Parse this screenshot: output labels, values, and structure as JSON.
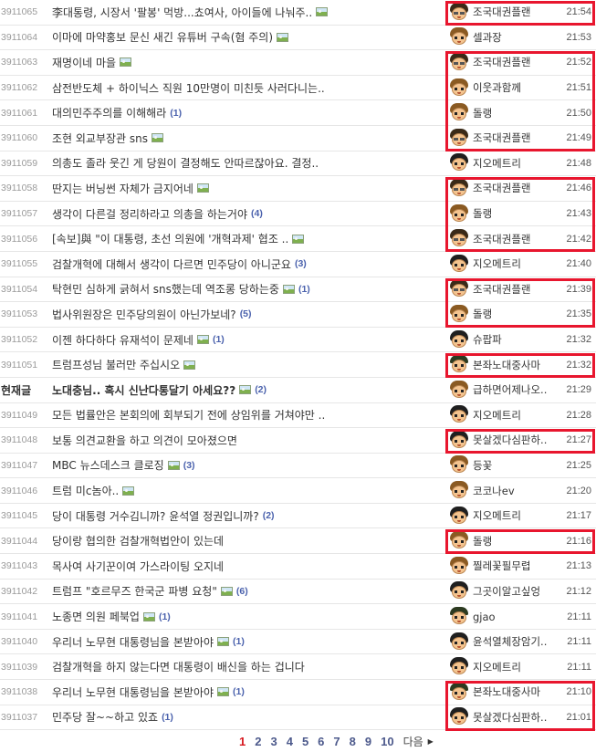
{
  "posts": [
    {
      "num": "3911065",
      "title": "李대통령, 시장서 '팔봉' 먹방...쵸여사, 아이들에 나눠주..",
      "img": true,
      "comments": "",
      "author": "조국대권플랜",
      "time": "21:54",
      "avatar": "glasses"
    },
    {
      "num": "3911064",
      "title": "이마에 마약홍보 문신 새긴 유튜버 구속(혐 주의)",
      "img": true,
      "comments": "",
      "author": "셀과장",
      "time": "21:53",
      "avatar": "light"
    },
    {
      "num": "3911063",
      "title": "재명이네 마을",
      "img": true,
      "comments": "",
      "author": "조국대권플랜",
      "time": "21:52",
      "avatar": "glasses"
    },
    {
      "num": "3911062",
      "title": "삼전반도체 + 하이닉스 직원 10만명이 미친듯 사러다니는..",
      "img": false,
      "comments": "",
      "author": "이웃과함께",
      "time": "21:51",
      "avatar": "light"
    },
    {
      "num": "3911061",
      "title": "대의민주주의를 이해해라",
      "img": false,
      "comments": "(1)",
      "author": "돌랭",
      "time": "21:50",
      "avatar": "light"
    },
    {
      "num": "3911060",
      "title": "조현 외교부장관 sns",
      "img": true,
      "comments": "",
      "author": "조국대권플랜",
      "time": "21:49",
      "avatar": "glasses"
    },
    {
      "num": "3911059",
      "title": "의총도 졸라 웃긴 게 당원이 결정해도 안따르잖아요. 결정..",
      "img": false,
      "comments": "",
      "author": "지오메트리",
      "time": "21:48",
      "avatar": "spiky"
    },
    {
      "num": "3911058",
      "title": "딴지는 버닝썬 자체가 금지어네",
      "img": true,
      "comments": "",
      "author": "조국대권플랜",
      "time": "21:46",
      "avatar": "glasses"
    },
    {
      "num": "3911057",
      "title": "생각이 다른걸 정리하라고 의총을 하는거야",
      "img": false,
      "comments": "(4)",
      "author": "돌랭",
      "time": "21:43",
      "avatar": "light"
    },
    {
      "num": "3911056",
      "title": "[속보]與 \"이 대통령, 초선 의원에 '개혁과제' 협조 ..",
      "img": true,
      "comments": "",
      "author": "조국대권플랜",
      "time": "21:42",
      "avatar": "glasses"
    },
    {
      "num": "3911055",
      "title": "검찰개혁에 대해서 생각이 다르면 민주당이 아니군요",
      "img": false,
      "comments": "(3)",
      "author": "지오메트리",
      "time": "21:40",
      "avatar": "spiky"
    },
    {
      "num": "3911054",
      "title": "탁현민 심하게 긁혀서 sns했는데 역조롱 당하는중",
      "img": true,
      "comments": "(1)",
      "author": "조국대권플랜",
      "time": "21:39",
      "avatar": "glasses"
    },
    {
      "num": "3911053",
      "title": "법사위원장은 민주당의원이 아닌가보네?",
      "img": false,
      "comments": "(5)",
      "author": "돌랭",
      "time": "21:35",
      "avatar": "light"
    },
    {
      "num": "3911052",
      "title": "이젠 하다하다 유재석이 문제네",
      "img": true,
      "comments": "(1)",
      "author": "슈팝파",
      "time": "21:32",
      "avatar": "spiky"
    },
    {
      "num": "3911051",
      "title": "트럼프성님 불러만 주십시오",
      "img": true,
      "comments": "",
      "author": "본좌노대중사마",
      "time": "21:32",
      "avatar": "cap"
    },
    {
      "num": "현재글",
      "title": "노대충님.. 혹시 신난다통달기 아세요??",
      "img": true,
      "comments": "(2)",
      "author": "급하면어제나오..",
      "time": "21:29",
      "avatar": "light",
      "notice": true
    },
    {
      "num": "3911049",
      "title": "모든 법률안은 본회의에 회부되기 전에 상임위를 거쳐야만 ..",
      "img": false,
      "comments": "",
      "author": "지오메트리",
      "time": "21:28",
      "avatar": "spiky"
    },
    {
      "num": "3911048",
      "title": "보통 의견교환을 하고 의견이 모아졌으면",
      "img": false,
      "comments": "",
      "author": "못살겠다심판하..",
      "time": "21:27",
      "avatar": "spiky"
    },
    {
      "num": "3911047",
      "title": "MBC 뉴스데스크 클로징",
      "img": true,
      "comments": "(3)",
      "author": "등꽃",
      "time": "21:25",
      "avatar": "light"
    },
    {
      "num": "3911046",
      "title": "트럼 미c놈아..",
      "img": true,
      "comments": "",
      "author": "코코나ev",
      "time": "21:20",
      "avatar": "light"
    },
    {
      "num": "3911045",
      "title": "당이 대통령 거수김니까? 윤석열 정권입니까?",
      "img": false,
      "comments": "(2)",
      "author": "지오메트리",
      "time": "21:17",
      "avatar": "spiky"
    },
    {
      "num": "3911044",
      "title": "당이랑 협의한 검찰개혁법안이 있는데",
      "img": false,
      "comments": "",
      "author": "돌랭",
      "time": "21:16",
      "avatar": "light"
    },
    {
      "num": "3911043",
      "title": "목사여 사기꾼이여 가스라이팅 오지네",
      "img": false,
      "comments": "",
      "author": "찔레꽃필무렵",
      "time": "21:13",
      "avatar": "light"
    },
    {
      "num": "3911042",
      "title": "트럼프 \"호르무즈 한국군 파병 요청\"",
      "img": true,
      "comments": "(6)",
      "author": "그곳이알고싶엉",
      "time": "21:12",
      "avatar": "spiky"
    },
    {
      "num": "3911041",
      "title": "노종면 의원 페북업",
      "img": true,
      "comments": "(1)",
      "author": "gjao",
      "time": "21:11",
      "avatar": "cap"
    },
    {
      "num": "3911040",
      "title": "우리너 노무현 대통령님을 본받아야",
      "img": true,
      "comments": "(1)",
      "author": "윤석열체장암기..",
      "time": "21:11",
      "avatar": "spiky"
    },
    {
      "num": "3911039",
      "title": "검찰개혁을 하지 않는다면 대통령이 배신을 하는 겁니다",
      "img": false,
      "comments": "",
      "author": "지오메트리",
      "time": "21:11",
      "avatar": "spiky"
    },
    {
      "num": "3911038",
      "title": "우리너 노무현 대통령님을 본받아야",
      "img": true,
      "comments": "(1)",
      "author": "본좌노대중사마",
      "time": "21:10",
      "avatar": "cap"
    },
    {
      "num": "3911037",
      "title": "민주당 잘~~하고 있죠",
      "img": false,
      "comments": "(1)",
      "author": "못살겠다심판하..",
      "time": "21:01",
      "avatar": "spiky"
    }
  ],
  "highlight_groups": [
    [
      0,
      0
    ],
    [
      2,
      5
    ],
    [
      7,
      9
    ],
    [
      11,
      12
    ],
    [
      14,
      14
    ],
    [
      17,
      17
    ],
    [
      21,
      21
    ],
    [
      27,
      28
    ]
  ],
  "pagination": {
    "pages": [
      "1",
      "2",
      "3",
      "4",
      "5",
      "6",
      "7",
      "8",
      "9",
      "10"
    ],
    "current": "1",
    "next_label": "다음",
    "next_icon": "triangle-right-icon"
  },
  "colors": {
    "highlight": "#e8162e",
    "current_page": "#d71920",
    "page_link": "#4d5a8c",
    "comment_count": "#4b62ad"
  }
}
